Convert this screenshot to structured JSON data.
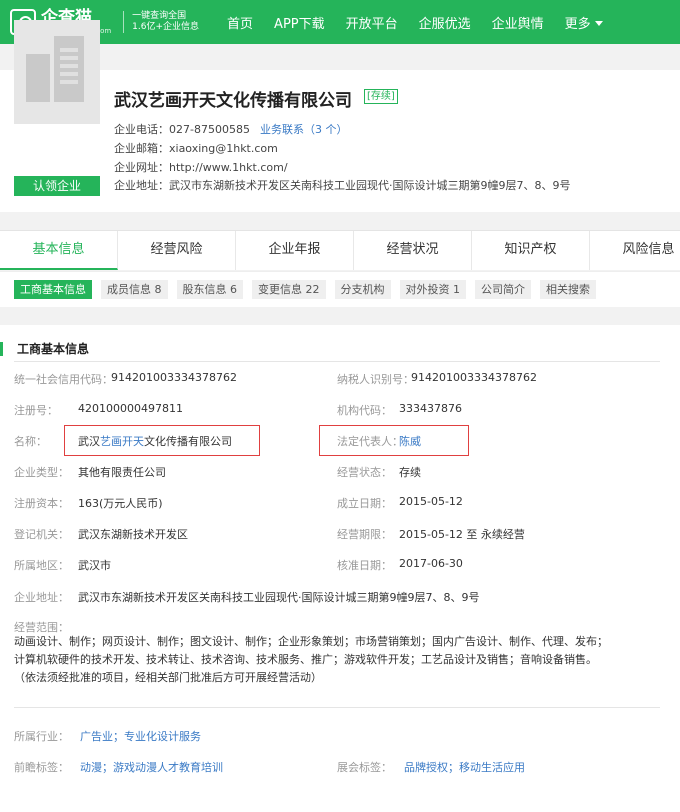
{
  "brand": {
    "name": "企查猫",
    "url": "www.qichamao.com",
    "slogan_line1": "一键查询全国",
    "slogan_line2": "1.6亿+企业信息"
  },
  "nav": {
    "items": [
      "首页",
      "APP下载",
      "开放平台",
      "企服优选",
      "企业舆情",
      "更多"
    ]
  },
  "company": {
    "name": "武汉艺画开天文化传播有限公司",
    "status": "[存续]",
    "claim_label": "认领企业",
    "phone_label": "企业电话：",
    "phone": "027-87500585",
    "business_contact": "业务联系（3 个）",
    "email_label": "企业邮箱：",
    "email": "xiaoxing@1hkt.com",
    "website_label": "企业网址：",
    "website": "http://www.1hkt.com/",
    "address_label": "企业地址：",
    "address": "武汉市东湖新技术开发区关南科技工业园现代·国际设计城三期第9幢9层7、8、9号"
  },
  "tabs": [
    "基本信息",
    "经营风险",
    "企业年报",
    "经营状况",
    "知识产权",
    "风险信息"
  ],
  "subtabs": [
    "工商基本信息",
    "成员信息 8",
    "股东信息 6",
    "变更信息 22",
    "分支机构",
    "对外投资 1",
    "公司简介",
    "相关搜索"
  ],
  "basic": {
    "section_title": "工商基本信息",
    "credit_code_label": "统一社会信用代码：",
    "credit_code": "914201003334378762",
    "taxpayer_label": "纳税人识别号：",
    "taxpayer": "914201003334378762",
    "reg_no_label": "注册号：",
    "reg_no": "420100000497811",
    "org_code_label": "机构代码：",
    "org_code": "333437876",
    "name_label": "名称：",
    "name_prefix": "武汉",
    "name_highlight": "艺画开天",
    "name_suffix": "文化传播有限公司",
    "legal_label": "法定代表人：",
    "legal_rep": "陈威",
    "type_label": "企业类型：",
    "type": "其他有限责任公司",
    "op_status_label": "经营状态：",
    "op_status": "存续",
    "capital_label": "注册资本：",
    "capital": "163(万元人民币)",
    "established_label": "成立日期：",
    "established": "2015-05-12",
    "authority_label": "登记机关：",
    "authority": "武汉东湖新技术开发区",
    "term_label": "经营期限：",
    "term": "2015-05-12 至 永续经营",
    "region_label": "所属地区：",
    "region": "武汉市",
    "approval_label": "核准日期：",
    "approval": "2017-06-30",
    "address_label": "企业地址：",
    "address": "武汉市东湖新技术开发区关南科技工业园现代·国际设计城三期第9幢9层7、8、9号",
    "scope_label": "经营范围：",
    "scope_line1": "动画设计、制作；网页设计、制作；图文设计、制作；企业形象策划；市场营销策划；国内广告设计、制作、代理、发布；",
    "scope_line2": "计算机软硬件的技术开发、技术转让、技术咨询、技术服务、推广；游戏软件开发；工艺品设计及销售；音响设备销售。",
    "scope_line3": "（依法须经批准的项目，经相关部门批准后方可开展经营活动）",
    "industry_label": "所属行业：",
    "industry": "广告业；专业化设计服务",
    "tags_label": "前瞻标签：",
    "tags": "动漫；游戏动漫人才教育培训",
    "expo_label": "展会标签：",
    "expo": "品牌授权；移动生活应用"
  }
}
